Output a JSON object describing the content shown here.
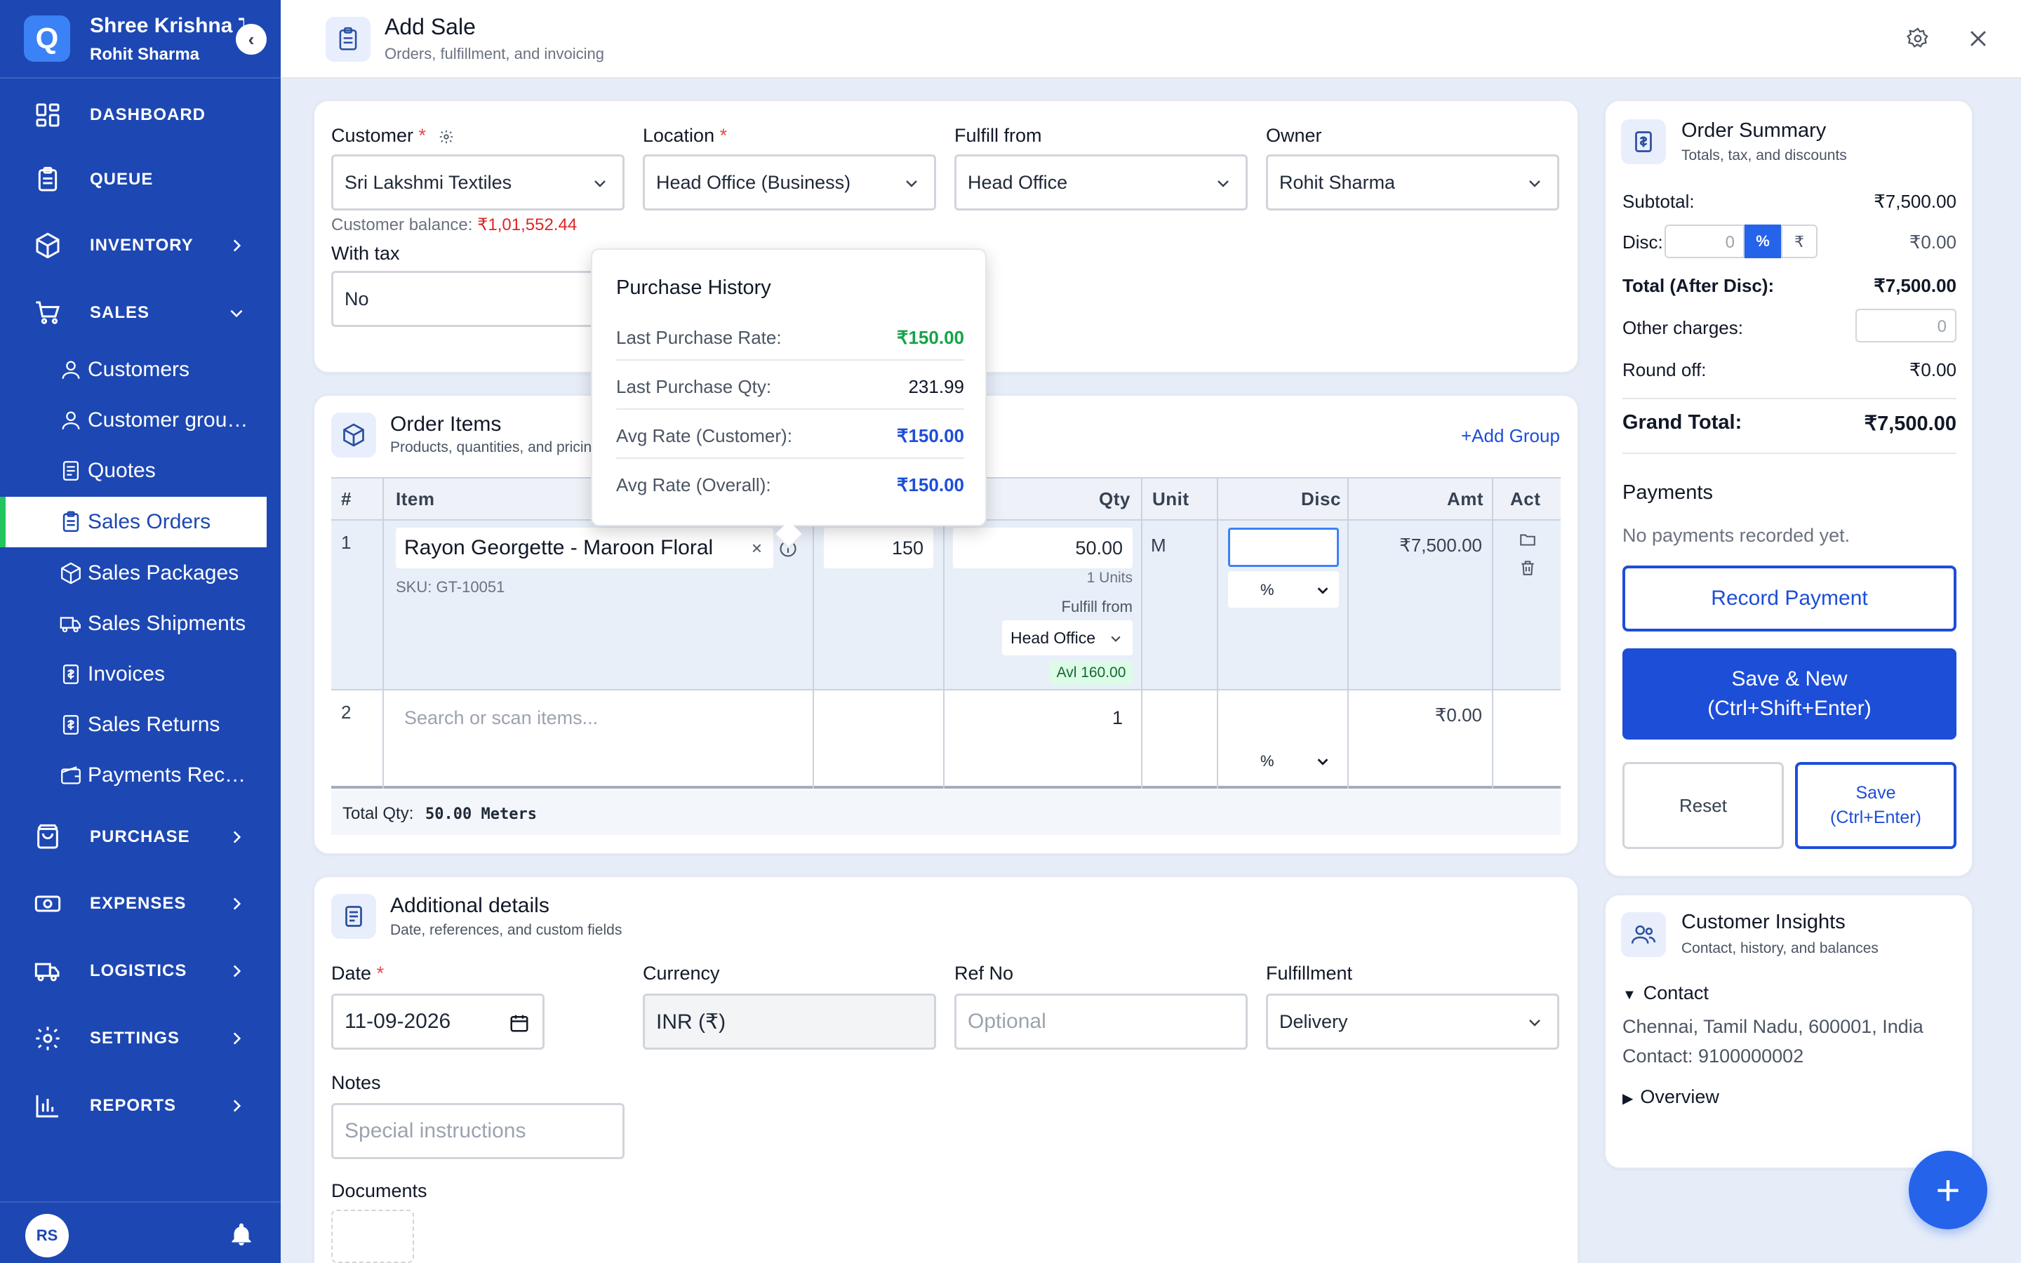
{
  "brand": {
    "logo": "Q",
    "company": "Shree Krishna Textiles",
    "user": "Rohit Sharma"
  },
  "nav": {
    "dashboard": "DASHBOARD",
    "queue": "QUEUE",
    "inventory": "INVENTORY",
    "sales": "SALES",
    "sales_sub": [
      "Customers",
      "Customer groups",
      "Quotes",
      "Sales Orders",
      "Sales Packages",
      "Sales Shipments",
      "Invoices",
      "Sales Returns",
      "Payments Received"
    ],
    "purchase": "PURCHASE",
    "expenses": "EXPENSES",
    "logistics": "LOGISTICS",
    "settings": "SETTINGS",
    "reports": "REPORTS",
    "avatar": "RS"
  },
  "header": {
    "title": "Add Sale",
    "subtitle": "Orders, fulfillment, and invoicing"
  },
  "customer_card": {
    "customer_label": "Customer",
    "customer_value": "Sri Lakshmi Textiles",
    "customer_balance_label": "Customer balance:",
    "customer_balance_value": "₹1,01,552.44",
    "location_label": "Location",
    "location_value": "Head Office (Business)",
    "fulfill_label": "Fulfill from",
    "fulfill_value": "Head Office",
    "owner_label": "Owner",
    "owner_value": "Rohit Sharma",
    "with_tax_label": "With tax",
    "with_tax_value": "No"
  },
  "purchase_history": {
    "title": "Purchase History",
    "rows": [
      {
        "label": "Last Purchase Rate:",
        "value": "₹150.00",
        "color": "#16a34a"
      },
      {
        "label": "Last Purchase Qty:",
        "value": "231.99",
        "color": "#111827"
      },
      {
        "label": "Avg Rate (Customer):",
        "value": "₹150.00",
        "color": "#1d4ed8"
      },
      {
        "label": "Avg Rate (Overall):",
        "value": "₹150.00",
        "color": "#1d4ed8"
      }
    ]
  },
  "order_items": {
    "title": "Order Items",
    "subtitle": "Products, quantities, and pricing",
    "add_group": "+Add Group",
    "columns": {
      "num": "#",
      "item": "Item",
      "qty": "Qty",
      "unit": "Unit",
      "disc": "Disc",
      "amt": "Amt",
      "act": "Act"
    },
    "rows": [
      {
        "num": "1",
        "item": "Rayon Georgette - Maroon Floral",
        "sku": "SKU: GT-10051",
        "rate": "150",
        "qty": "50.00",
        "units_note": "1 Units",
        "fulfill_from_label": "Fulfill from",
        "fulfill_from_value": "Head Office",
        "available": "Avl 160.00",
        "unit": "M",
        "disc_type": "%",
        "amt": "₹7,500.00"
      },
      {
        "num": "2",
        "item_placeholder": "Search or scan items...",
        "qty": "1",
        "disc_type": "%",
        "amt": "₹0.00"
      }
    ],
    "total_qty_label": "Total Qty:",
    "total_qty_value": "50.00 Meters"
  },
  "additional": {
    "title": "Additional details",
    "subtitle": "Date, references, and custom fields",
    "date_label": "Date",
    "date_value": "11-09-2026",
    "currency_label": "Currency",
    "currency_value": "INR (₹)",
    "ref_label": "Ref No",
    "ref_placeholder": "Optional",
    "fulfillment_label": "Fulfillment",
    "fulfillment_value": "Delivery",
    "notes_label": "Notes",
    "notes_placeholder": "Special instructions",
    "documents_label": "Documents"
  },
  "summary": {
    "title": "Order Summary",
    "subtitle": "Totals, tax, and discounts",
    "subtotal_label": "Subtotal:",
    "subtotal_value": "₹7,500.00",
    "disc_label": "Disc:",
    "disc_input": "0",
    "disc_pct": "%",
    "disc_rupee": "₹",
    "disc_value": "₹0.00",
    "total_after_label": "Total (After Disc):",
    "total_after_value": "₹7,500.00",
    "other_label": "Other charges:",
    "other_value": "0",
    "roundoff_label": "Round off:",
    "roundoff_value": "₹0.00",
    "grand_label": "Grand Total:",
    "grand_value": "₹7,500.00",
    "payments_title": "Payments",
    "payments_empty": "No payments recorded yet.",
    "record_payment": "Record Payment",
    "save_new_line1": "Save & New",
    "save_new_line2": "(Ctrl+Shift+Enter)",
    "reset": "Reset",
    "save_line1": "Save",
    "save_line2": "(Ctrl+Enter)"
  },
  "insights": {
    "title": "Customer Insights",
    "subtitle": "Contact, history, and balances",
    "contact_label": "Contact",
    "address": "Chennai, Tamil Nadu, 600001, India",
    "contact_line": "Contact: 9100000002",
    "overview_label": "Overview"
  },
  "fab": "+"
}
